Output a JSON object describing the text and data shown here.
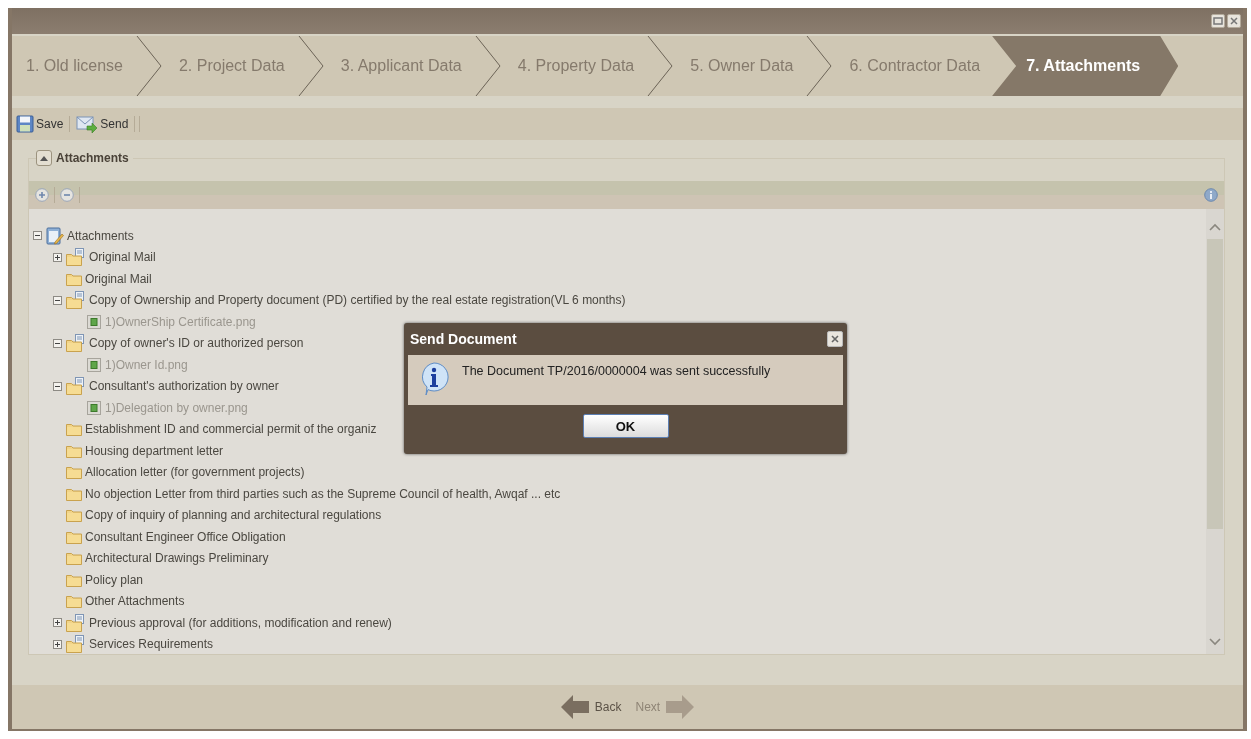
{
  "steps": [
    {
      "label": "1. Old license",
      "selected": false
    },
    {
      "label": "2. Project Data",
      "selected": false
    },
    {
      "label": "3. Applicant Data",
      "selected": false
    },
    {
      "label": "4. Property Data",
      "selected": false
    },
    {
      "label": "5. Owner Data",
      "selected": false
    },
    {
      "label": "6. Contractor Data",
      "selected": false
    },
    {
      "label": "7. Attachments",
      "selected": true
    }
  ],
  "toolbar": [
    {
      "kind": "save",
      "label": "Save"
    },
    {
      "kind": "send",
      "label": "Send"
    }
  ],
  "panel": {
    "title": "Attachments",
    "expanded": true
  },
  "tree": {
    "label": "Attachments",
    "kind": "root",
    "expanded": true,
    "children": [
      {
        "label": "Original Mail",
        "kind": "group",
        "expanded": false
      },
      {
        "label": "Original Mail",
        "kind": "folder"
      },
      {
        "label": "Copy of Ownership and Property document (PD) certified by the real estate registration(VL 6 months)",
        "kind": "group",
        "expanded": true,
        "children": [
          {
            "label": "1)OwnerShip Certificate.png",
            "kind": "file"
          }
        ]
      },
      {
        "label": "Copy of owner's ID or authorized person",
        "kind": "group",
        "expanded": true,
        "children": [
          {
            "label": "1)Owner Id.png",
            "kind": "file"
          }
        ]
      },
      {
        "label": "Consultant's authorization by owner",
        "kind": "group",
        "expanded": true,
        "children": [
          {
            "label": "1)Delegation by owner.png",
            "kind": "file"
          }
        ]
      },
      {
        "label": "Establishment ID and commercial permit of the organiz",
        "kind": "folder"
      },
      {
        "label": "Housing department letter",
        "kind": "folder"
      },
      {
        "label": "Allocation letter (for government projects)",
        "kind": "folder"
      },
      {
        "label": "No objection Letter from third parties such as the Supreme Council of health, Awqaf ... etc",
        "kind": "folder"
      },
      {
        "label": "Copy of inquiry of planning and architectural regulations",
        "kind": "folder"
      },
      {
        "label": "Consultant Engineer Office Obligation",
        "kind": "folder"
      },
      {
        "label": "Architectural Drawings Preliminary",
        "kind": "folder"
      },
      {
        "label": "Policy plan",
        "kind": "folder"
      },
      {
        "label": "Other Attachments",
        "kind": "folder"
      },
      {
        "label": "Previous approval (for additions, modification and renew)",
        "kind": "group",
        "expanded": false
      },
      {
        "label": "Services Requirements",
        "kind": "group",
        "expanded": false
      }
    ]
  },
  "dialog": {
    "title": "Send Document",
    "message": "The Document TP/2016/0000004 was sent successfully",
    "button": "OK"
  },
  "nav": [
    {
      "kind": "back",
      "label": "Back",
      "disabled": false
    },
    {
      "kind": "next",
      "label": "Next",
      "disabled": true
    }
  ]
}
